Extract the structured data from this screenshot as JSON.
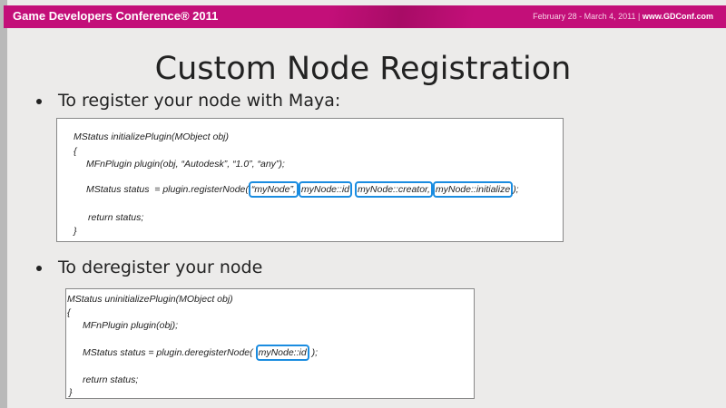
{
  "header": {
    "conference": "Game Developers Conference® 2011",
    "dates": "February 28 - March 4, 2011 |",
    "url": "www.GDConf.com"
  },
  "slide": {
    "title": "Custom Node Registration",
    "bullets": [
      "To register your node with Maya:",
      "To deregister your node"
    ],
    "register_code": {
      "l1": "MStatus initializePlugin(MObject obj)",
      "l2": "{",
      "l3": "MFnPlugin plugin(obj, “Autodesk”, “1.0”, “any”);",
      "l4_pre": "MStatus status  = plugin.registerNode(",
      "h1": "“myNode”,",
      "h2": "myNode::id",
      "h3": "myNode::creator,",
      "h4": "myNode::initialize",
      "l4_post": ");",
      "l5": "return status;",
      "l6": "}"
    },
    "deregister_code": {
      "l1": "MStatus uninitializePlugin(MObject obj)",
      "l2": "{",
      "l3": "MFnPlugin plugin(obj);",
      "l4_pre": "MStatus status = plugin.deregisterNode(",
      "h1": "myNode::id",
      "l4_post": ");",
      "l5": "return status;",
      "l6": "}"
    }
  }
}
